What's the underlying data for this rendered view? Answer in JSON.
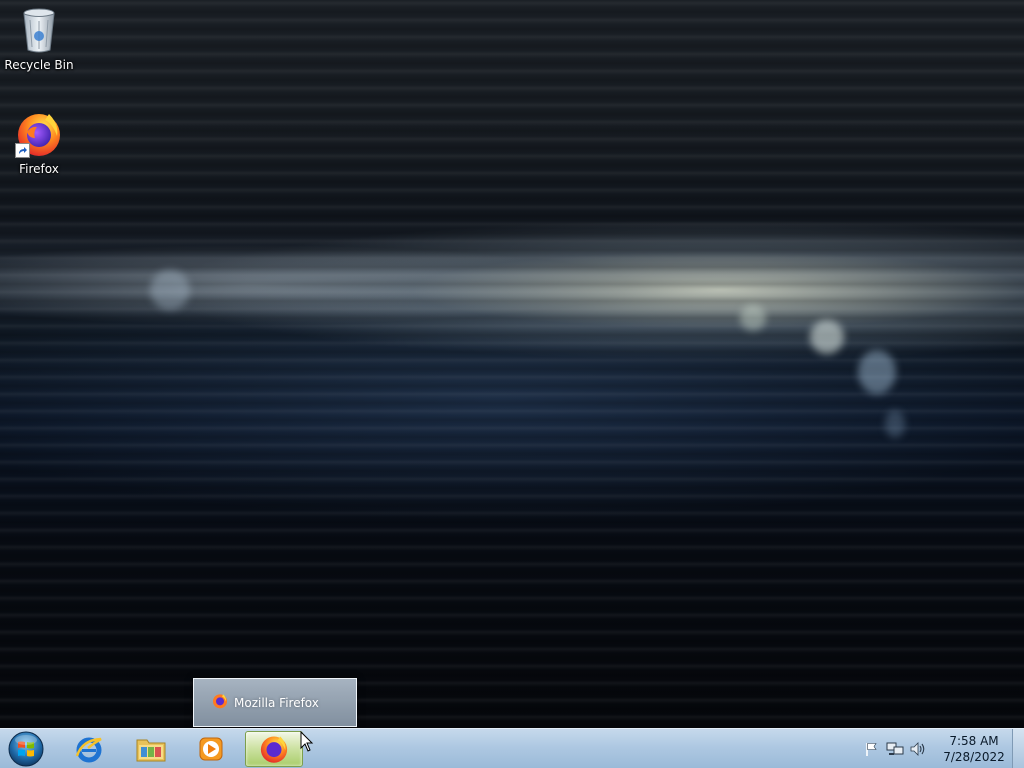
{
  "desktop": {
    "icons": [
      {
        "label": "Recycle Bin",
        "icon": "recycle-bin-icon"
      },
      {
        "label": "Firefox",
        "icon": "firefox-icon",
        "shortcut": true
      }
    ]
  },
  "taskbar": {
    "start_icon": "windows-start-orb",
    "pinned": [
      {
        "name": "internet-explorer",
        "icon": "ie-icon"
      },
      {
        "name": "windows-explorer",
        "icon": "folder-icon"
      },
      {
        "name": "windows-media-player",
        "icon": "media-player-icon"
      },
      {
        "name": "firefox",
        "icon": "firefox-icon",
        "active": true
      }
    ],
    "thumbnail_popup": {
      "title": "Mozilla Firefox",
      "icon": "firefox-icon"
    },
    "tray": {
      "icons": [
        "action-center-flag-icon",
        "network-icon",
        "volume-icon"
      ],
      "time": "7:58 AM",
      "date": "7/28/2022"
    }
  },
  "colors": {
    "taskbar_top": "#c6d9ec",
    "taskbar_bottom": "#9bbad8",
    "active_button": "#a9cd6a"
  }
}
